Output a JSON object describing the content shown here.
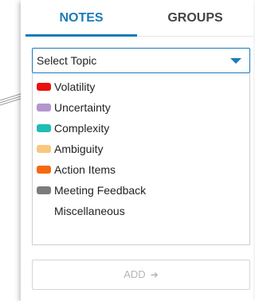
{
  "tabs": [
    {
      "label": "NOTES",
      "active": true
    },
    {
      "label": "GROUPS",
      "active": false
    }
  ],
  "accent_color": "#1a7bb9",
  "topic_select": {
    "value": "Select Topic",
    "caret_icon": "caret-down-icon"
  },
  "topics": [
    {
      "label": "Volatility",
      "color": "#e8110f"
    },
    {
      "label": "Uncertainty",
      "color": "#b495cf"
    },
    {
      "label": "Complexity",
      "color": "#1fbcb6"
    },
    {
      "label": "Ambiguity",
      "color": "#f9c77c"
    },
    {
      "label": "Action Items",
      "color": "#f4690e"
    },
    {
      "label": "Meeting Feedback",
      "color": "#7c7c7c"
    },
    {
      "label": "Miscellaneous",
      "color": null
    }
  ],
  "add_button": {
    "label": "ADD",
    "icon": "arrow-right-icon"
  }
}
